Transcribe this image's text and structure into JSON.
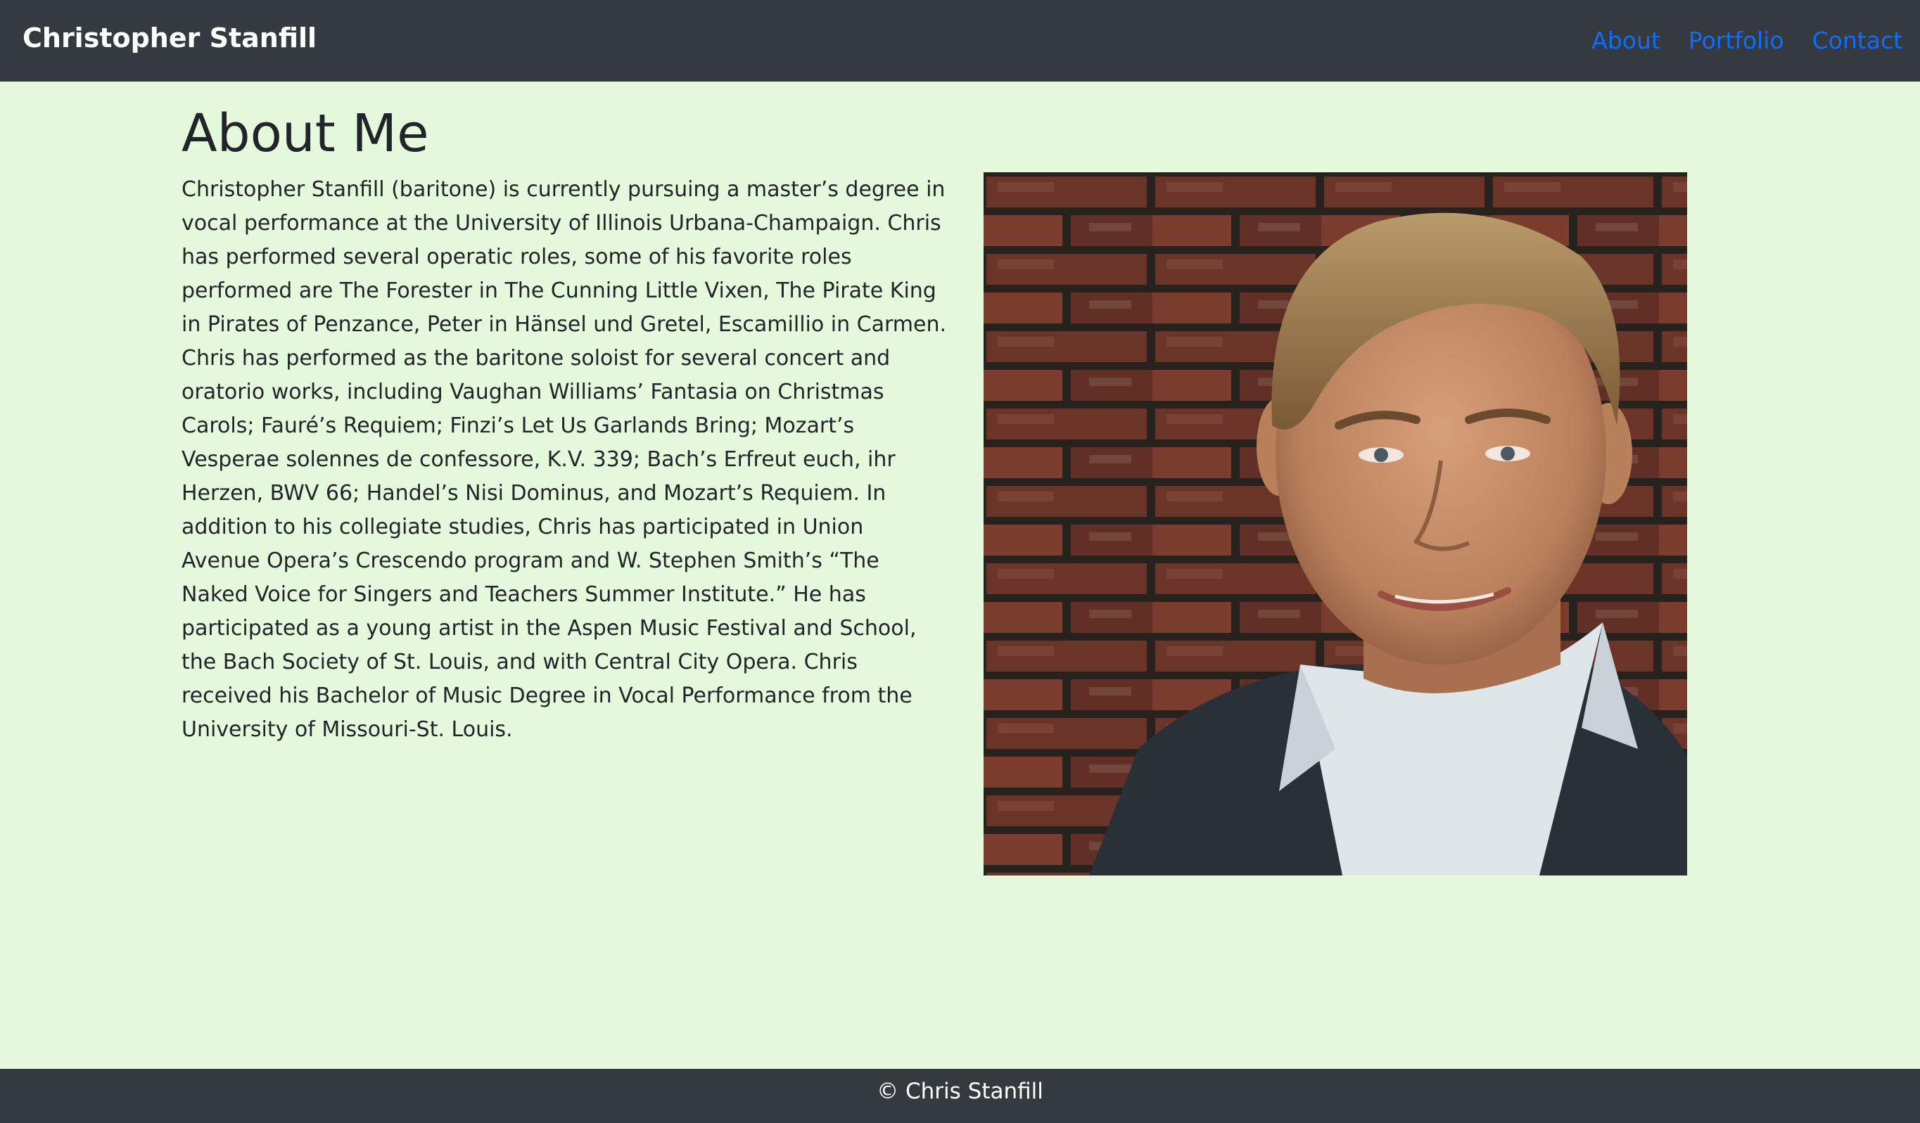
{
  "header": {
    "brand": "Christopher Stanfill",
    "nav": [
      "About",
      "Portfolio",
      "Contact"
    ]
  },
  "main": {
    "title": "About Me",
    "bio": "Christopher Stanfill (baritone) is currently pursuing a master’s degree in vocal performance at the University of Illinois Urbana-Champaign. Chris has performed several operatic roles, some of his favorite roles performed are The Forester in The Cunning Little Vixen, The Pirate King in Pirates of Penzance, Peter in Hänsel und Gretel, Escamillio in Carmen. Chris has performed as the baritone soloist for several concert and oratorio works, including Vaughan Williams’ Fantasia on Christmas Carols; Fauré’s Requiem; Finzi’s Let Us Garlands Bring; Mozart’s Vesperae solennes de confessore, K.V. 339; Bach’s Erfreut euch, ihr Herzen, BWV 66; Handel’s Nisi Dominus, and Mozart’s Requiem. In addition to his collegiate studies, Chris has participated in Union Avenue Opera’s Crescendo program and W. Stephen Smith’s “The Naked Voice for Singers and Teachers Summer Institute.” He has participated as a young artist in the Aspen Music Festival and School, the Bach Society of St. Louis, and with Central City Opera. Chris received his Bachelor of Music Degree in Vocal Performance from the University of Missouri-St. Louis."
  },
  "footer": {
    "copyright": "© Chris Stanfill"
  },
  "colors": {
    "navbar_bg": "#343a40",
    "page_bg": "#e5f9dc",
    "link": "#0d6efd",
    "text": "#212529"
  }
}
